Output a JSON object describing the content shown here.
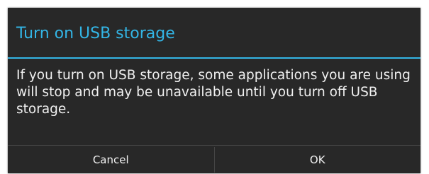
{
  "dialog": {
    "title": "Turn on USB storage",
    "message": "If you turn on USB storage, some applications you are using will stop and may be unavailable until you turn off USB storage.",
    "buttons": {
      "cancel_label": "Cancel",
      "ok_label": "OK"
    }
  },
  "colors": {
    "accent": "#33b5e5",
    "dialog_background": "#282828",
    "text": "#f0f0f0"
  }
}
